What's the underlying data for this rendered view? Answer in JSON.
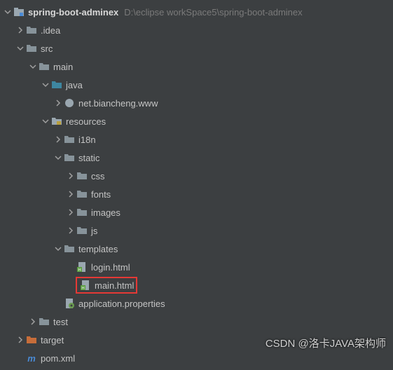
{
  "root": {
    "name": "spring-boot-adminex",
    "path": "D:\\eclipse workSpace5\\spring-boot-adminex"
  },
  "tree": {
    "idea": ".idea",
    "src": "src",
    "main": "main",
    "java": "java",
    "package": "net.biancheng.www",
    "resources": "resources",
    "i18n": "i18n",
    "static": "static",
    "css": "css",
    "fonts": "fonts",
    "images": "images",
    "js": "js",
    "templates": "templates",
    "login": "login.html",
    "mainhtml": "main.html",
    "appprops": "application.properties",
    "test": "test",
    "target": "target",
    "pom": "pom.xml"
  },
  "watermark": "CSDN @洛卡JAVA架构师"
}
